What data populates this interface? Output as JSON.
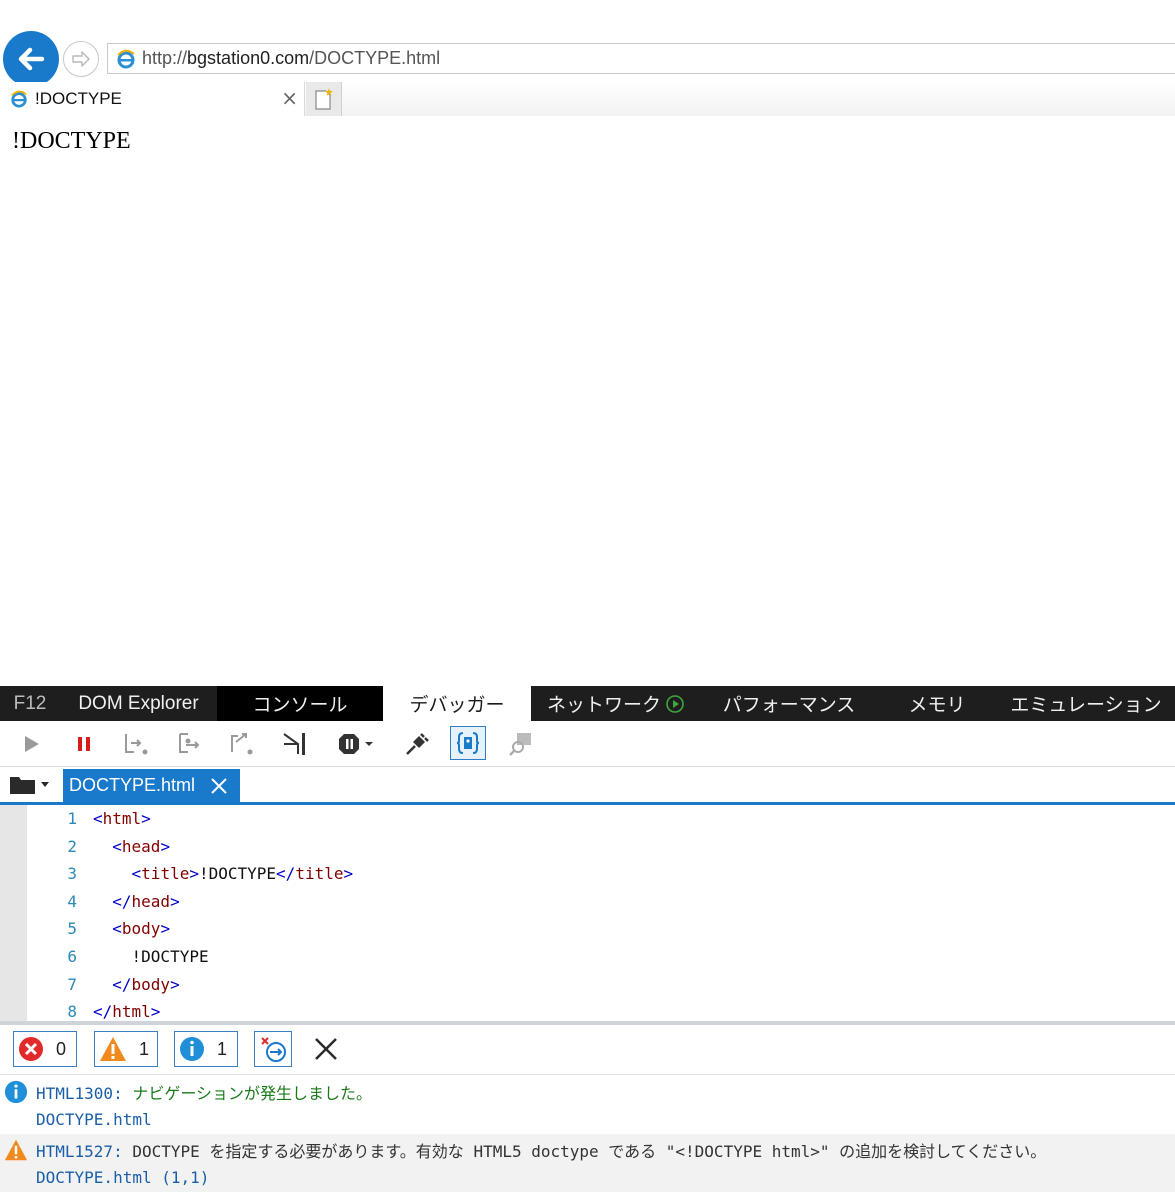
{
  "browser": {
    "url_scheme": "http://",
    "url_host": "bgstation0.com",
    "url_path": "/DOCTYPE.html",
    "tab_title": "!DOCTYPE",
    "tab_close": "×"
  },
  "page": {
    "body_text": "!DOCTYPE"
  },
  "devtools": {
    "tabs": [
      {
        "label": "F12"
      },
      {
        "label": "DOM Explorer"
      },
      {
        "label": "コンソール"
      },
      {
        "label": "デバッガー"
      },
      {
        "label": "ネットワーク"
      },
      {
        "label": "パフォーマンス"
      },
      {
        "label": "メモリ"
      },
      {
        "label": "エミュレーション"
      }
    ],
    "active_tab": "デバッガー",
    "open_file": "DOCTYPE.html",
    "code_lines": [
      {
        "n": "1",
        "indent": "",
        "parts": [
          [
            "b",
            "<"
          ],
          [
            "t",
            "html"
          ],
          [
            "b",
            ">"
          ]
        ]
      },
      {
        "n": "2",
        "indent": "  ",
        "parts": [
          [
            "b",
            "<"
          ],
          [
            "t",
            "head"
          ],
          [
            "b",
            ">"
          ]
        ]
      },
      {
        "n": "3",
        "indent": "    ",
        "parts": [
          [
            "b",
            "<"
          ],
          [
            "t",
            "title"
          ],
          [
            "b",
            ">"
          ],
          [
            "x",
            "!DOCTYPE"
          ],
          [
            "b",
            "</"
          ],
          [
            "t",
            "title"
          ],
          [
            "b",
            ">"
          ]
        ]
      },
      {
        "n": "4",
        "indent": "  ",
        "parts": [
          [
            "b",
            "</"
          ],
          [
            "t",
            "head"
          ],
          [
            "b",
            ">"
          ]
        ]
      },
      {
        "n": "5",
        "indent": "  ",
        "parts": [
          [
            "b",
            "<"
          ],
          [
            "t",
            "body"
          ],
          [
            "b",
            ">"
          ]
        ]
      },
      {
        "n": "6",
        "indent": "    ",
        "parts": [
          [
            "x",
            "!DOCTYPE"
          ]
        ]
      },
      {
        "n": "7",
        "indent": "  ",
        "parts": [
          [
            "b",
            "</"
          ],
          [
            "t",
            "body"
          ],
          [
            "b",
            ">"
          ]
        ]
      },
      {
        "n": "8",
        "indent": "",
        "parts": [
          [
            "b",
            "</"
          ],
          [
            "t",
            "html"
          ],
          [
            "b",
            ">"
          ]
        ]
      }
    ],
    "console": {
      "error_count": "0",
      "warning_count": "1",
      "info_count": "1",
      "messages": [
        {
          "type": "info",
          "code": "HTML1300:",
          "text": "ナビゲーションが発生しました。",
          "source": "DOCTYPE.html"
        },
        {
          "type": "warning",
          "code": "HTML1527:",
          "text": "DOCTYPE を指定する必要があります。有効な HTML5 doctype である \"<!DOCTYPE html>\" の追加を検討してください。",
          "source": "DOCTYPE.html (1,1)"
        }
      ]
    }
  },
  "colors": {
    "accent": "#1979ca",
    "devtools_bar": "#1e1e1e",
    "tag": "#800000",
    "bracket": "#0000cc"
  }
}
